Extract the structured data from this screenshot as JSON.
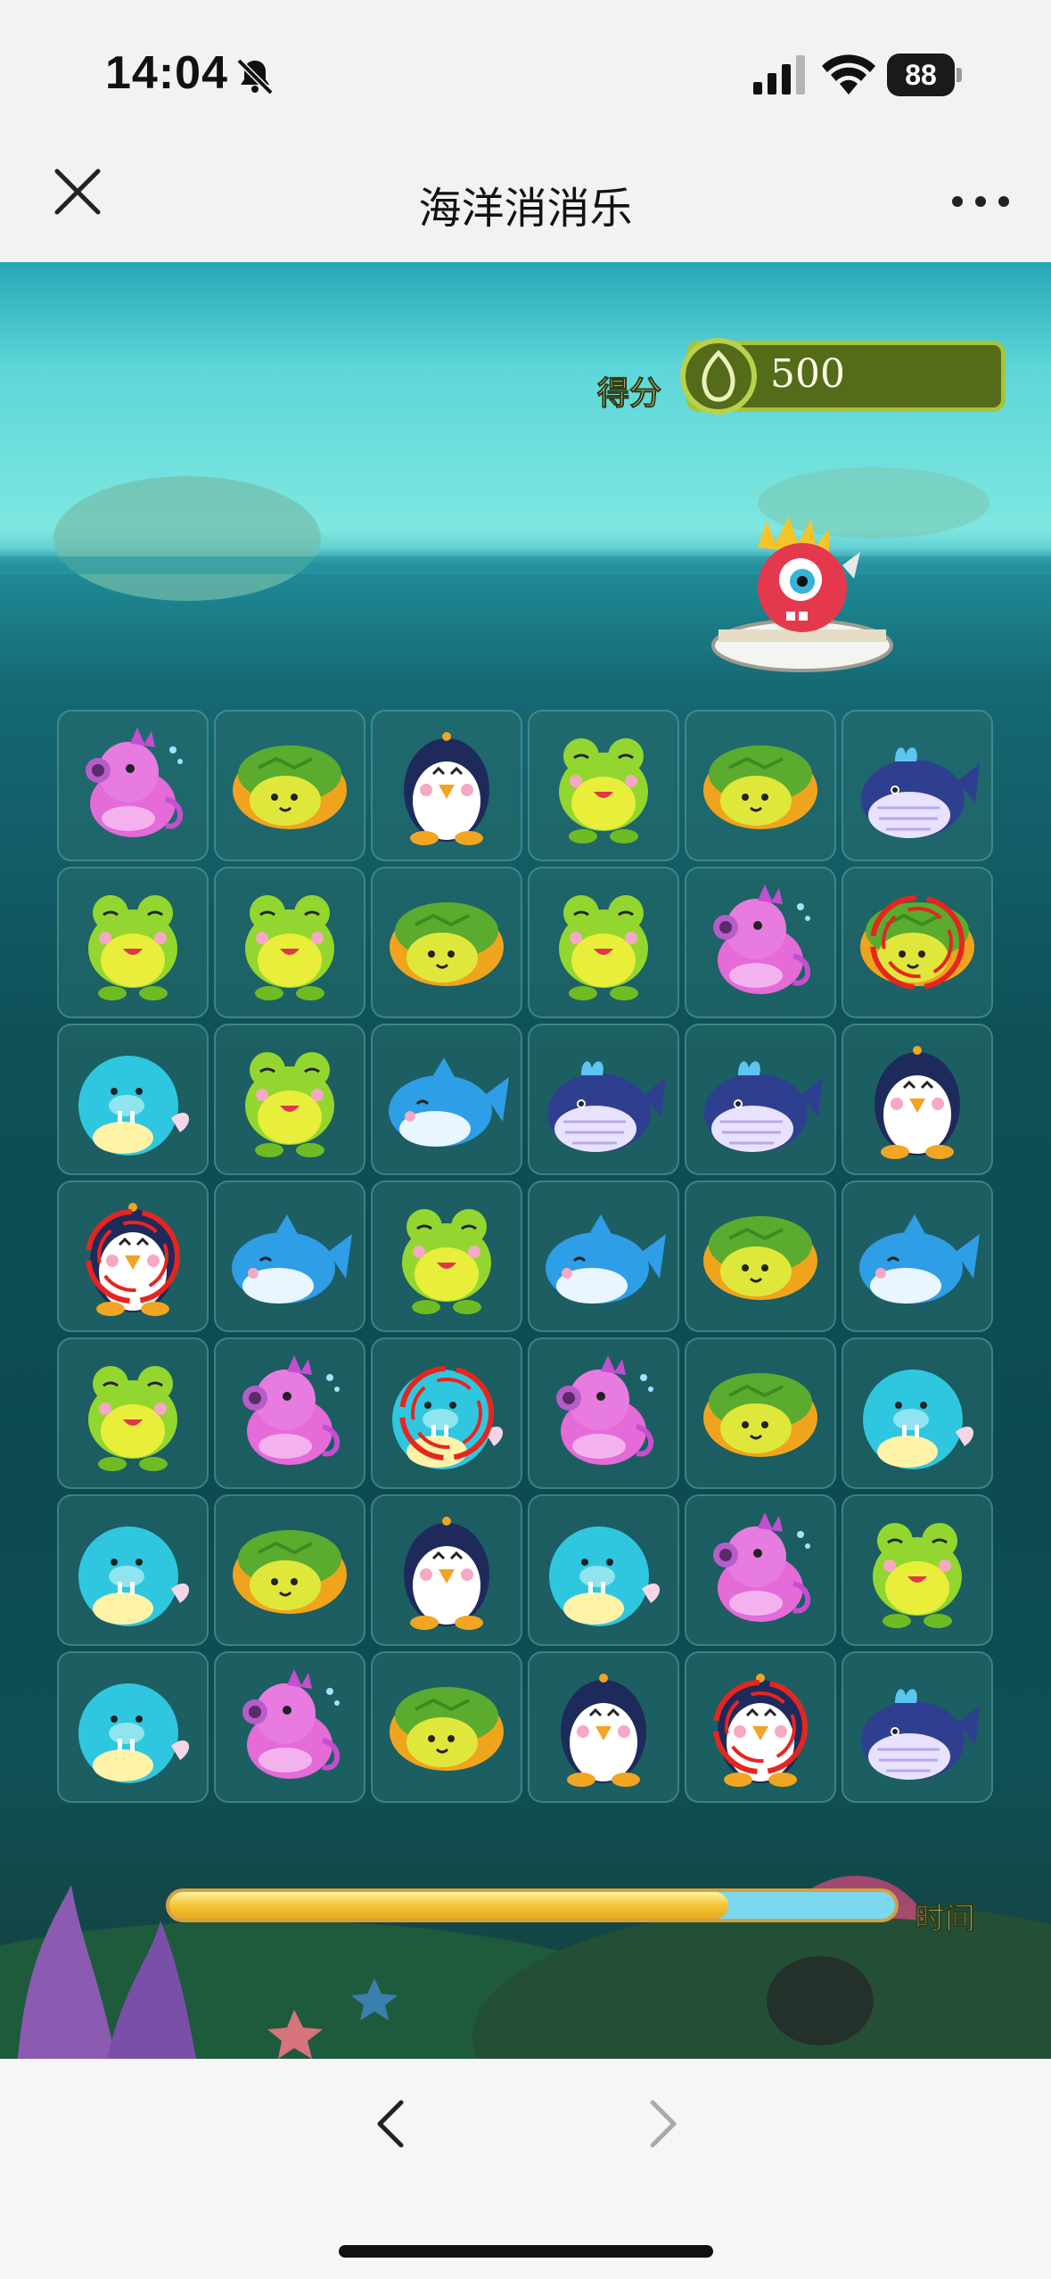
{
  "status_bar": {
    "time": "14:04",
    "battery": "88",
    "icons": [
      "bell-slash-icon",
      "signal-icon",
      "wifi-icon",
      "battery-icon"
    ]
  },
  "nav": {
    "title": "海洋消消乐",
    "close_icon": "close-icon",
    "more_icon": "more-icon"
  },
  "game": {
    "score_label": "得分",
    "score_value": "500",
    "time_label": "时间",
    "time_remaining_fraction": 0.77,
    "colors": {
      "score_box": "#546b1a",
      "score_border": "#a7c33a",
      "time_fill": "#f4c534",
      "time_track": "#7ad8ef"
    },
    "board": [
      [
        "seahorse",
        "turtle",
        "penguin",
        "frog",
        "turtle",
        "whale"
      ],
      [
        "frog",
        "frog",
        "turtle",
        "frog",
        "seahorse",
        "turtle"
      ],
      [
        "walrus",
        "frog",
        "dolphin",
        "whale",
        "whale",
        "penguin"
      ],
      [
        "penguin",
        "dolphin",
        "frog",
        "dolphin",
        "turtle",
        "dolphin"
      ],
      [
        "frog",
        "seahorse",
        "walrus",
        "seahorse",
        "turtle",
        "walrus"
      ],
      [
        "walrus",
        "turtle",
        "penguin",
        "walrus",
        "seahorse",
        "frog"
      ],
      [
        "walrus",
        "seahorse",
        "turtle",
        "penguin",
        "penguin",
        "whale"
      ]
    ],
    "marked_cells": [
      [
        1,
        5
      ],
      [
        3,
        0
      ],
      [
        4,
        2
      ],
      [
        6,
        4
      ]
    ]
  },
  "bottom_nav": {
    "back_icon": "chevron-left-icon",
    "forward_icon": "chevron-right-icon"
  }
}
